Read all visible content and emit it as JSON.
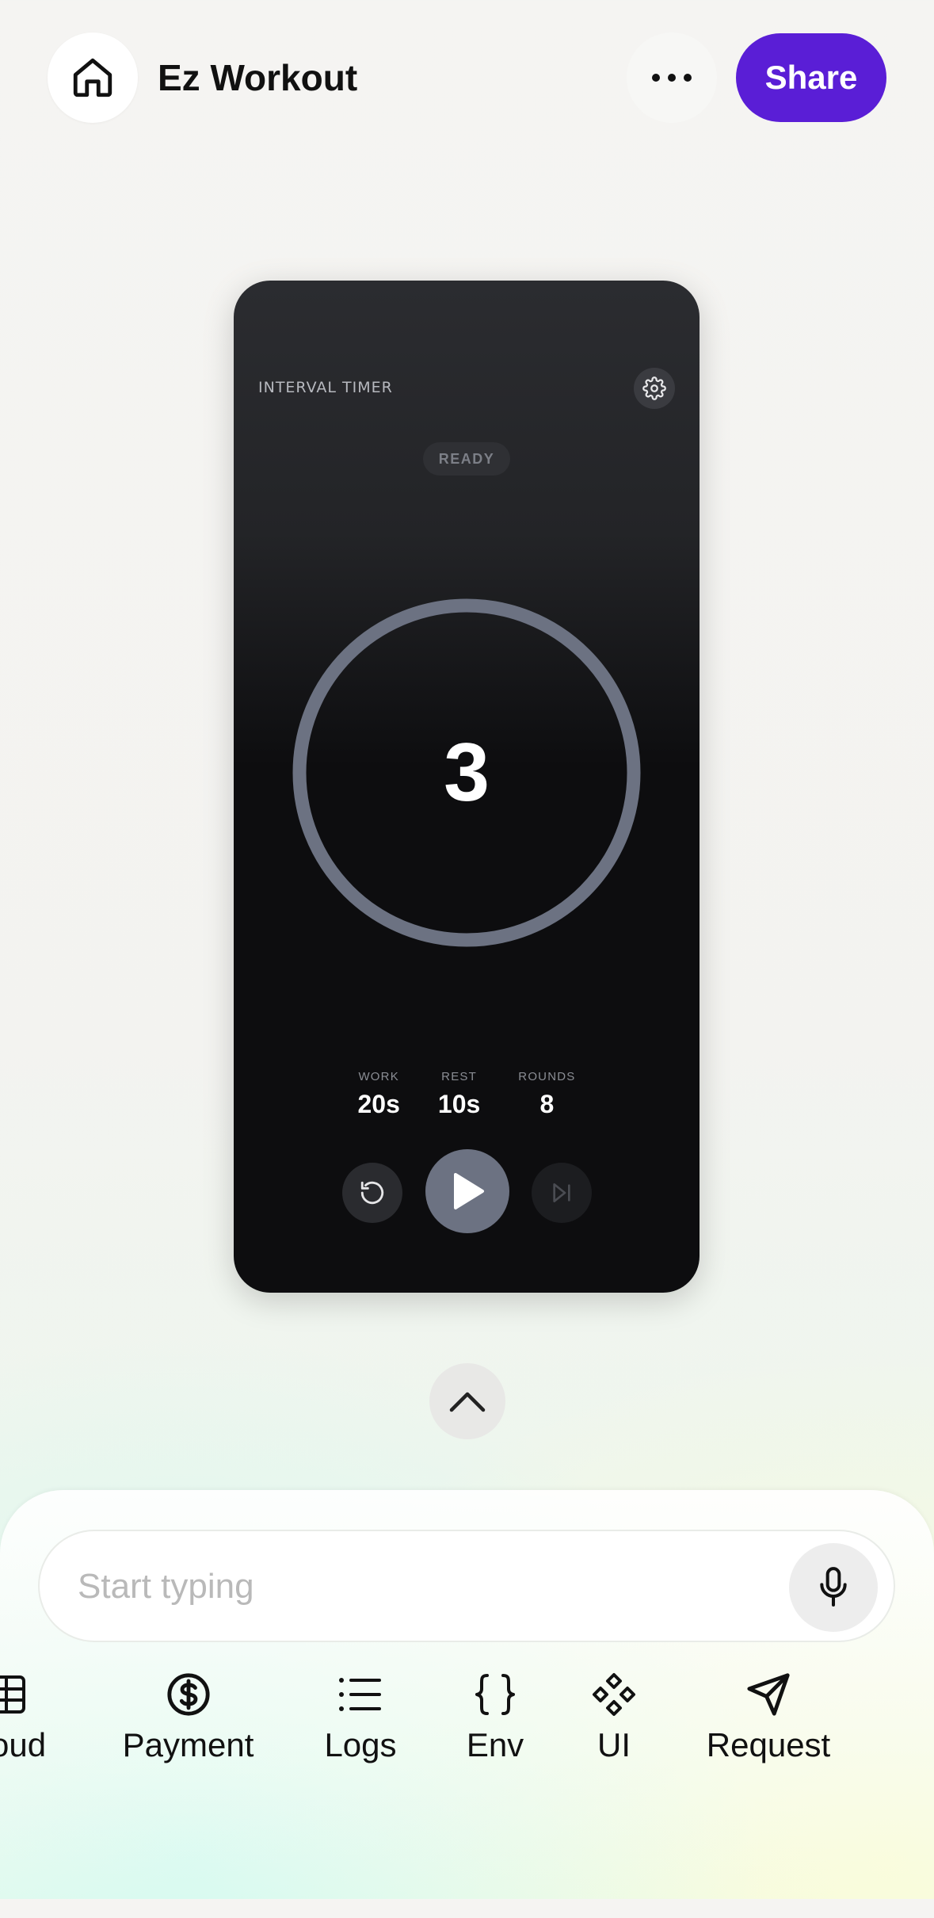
{
  "header": {
    "title": "Ez Workout",
    "share_label": "Share",
    "home_icon": "home-icon",
    "more_icon": "more-horizontal-icon"
  },
  "timer": {
    "label": "INTERVAL TIMER",
    "status": "READY",
    "count": "3",
    "stats": [
      {
        "label": "WORK",
        "value": "20s"
      },
      {
        "label": "REST",
        "value": "10s"
      },
      {
        "label": "ROUNDS",
        "value": "8"
      }
    ],
    "ring_color": "#6c7282",
    "play_button_color": "#6c7282"
  },
  "composer": {
    "placeholder": "Start typing"
  },
  "tools": [
    {
      "label": "Cloud",
      "visible_text": "oud",
      "icon": "table-icon"
    },
    {
      "label": "Payment",
      "icon": "dollar-circle-icon"
    },
    {
      "label": "Logs",
      "icon": "list-icon"
    },
    {
      "label": "Env",
      "icon": "braces-icon"
    },
    {
      "label": "UI",
      "icon": "components-icon"
    },
    {
      "label": "Request",
      "icon": "send-icon"
    }
  ],
  "colors": {
    "accent": "#5a1ed6"
  }
}
